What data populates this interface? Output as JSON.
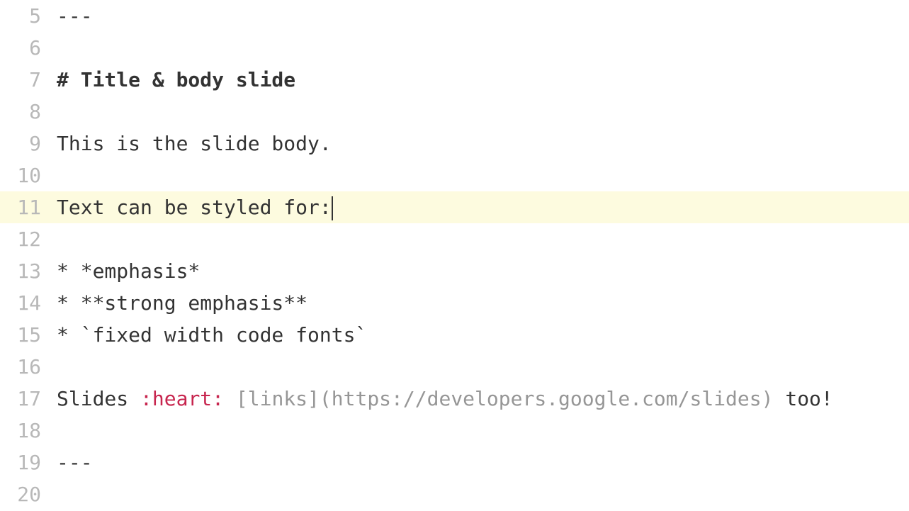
{
  "editor": {
    "active_line_index": 6,
    "lines": [
      {
        "num": "5",
        "segments": [
          {
            "t": "---",
            "cls": "token-hr"
          }
        ]
      },
      {
        "num": "6",
        "segments": []
      },
      {
        "num": "7",
        "segments": [
          {
            "t": "# Title & body slide",
            "cls": "token-head"
          }
        ]
      },
      {
        "num": "8",
        "segments": []
      },
      {
        "num": "9",
        "segments": [
          {
            "t": "This is the slide body.",
            "cls": "token-plain"
          }
        ]
      },
      {
        "num": "10",
        "segments": []
      },
      {
        "num": "11",
        "segments": [
          {
            "t": "Text can be styled for:",
            "cls": "token-plain"
          }
        ],
        "cursor_after": true
      },
      {
        "num": "12",
        "segments": []
      },
      {
        "num": "13",
        "segments": [
          {
            "t": "* *emphasis*",
            "cls": "token-plain"
          }
        ]
      },
      {
        "num": "14",
        "segments": [
          {
            "t": "* **strong emphasis**",
            "cls": "token-plain"
          }
        ]
      },
      {
        "num": "15",
        "segments": [
          {
            "t": "* `fixed width code fonts`",
            "cls": "token-plain"
          }
        ]
      },
      {
        "num": "16",
        "segments": []
      },
      {
        "num": "17",
        "segments": [
          {
            "t": "Slides ",
            "cls": "token-plain"
          },
          {
            "t": ":heart:",
            "cls": "token-red"
          },
          {
            "t": " ",
            "cls": "token-plain"
          },
          {
            "t": "[links](https://developers.google.com/slides)",
            "cls": "token-dim"
          },
          {
            "t": " too!",
            "cls": "token-plain"
          }
        ]
      },
      {
        "num": "18",
        "segments": []
      },
      {
        "num": "19",
        "segments": [
          {
            "t": "---",
            "cls": "token-hr"
          }
        ]
      },
      {
        "num": "20",
        "segments": []
      }
    ]
  }
}
